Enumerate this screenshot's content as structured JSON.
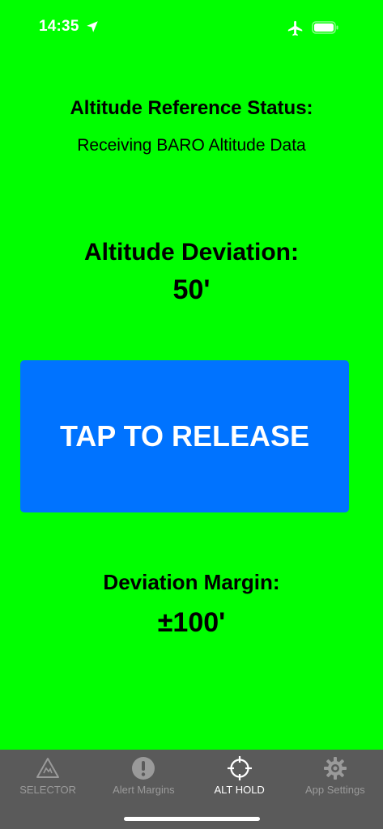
{
  "status_bar": {
    "time": "14:35",
    "icons": [
      "location-arrow-icon",
      "airplane-icon",
      "battery-icon"
    ]
  },
  "altitude_reference": {
    "title": "Altitude Reference Status:",
    "status": "Receiving BARO Altitude Data"
  },
  "altitude_deviation": {
    "title": "Altitude Deviation:",
    "value": "50'"
  },
  "release_button": {
    "label": "TAP TO RELEASE"
  },
  "deviation_margin": {
    "title": "Deviation Margin:",
    "value": "±100'"
  },
  "tabs": [
    {
      "label": "SELECTOR",
      "icon": "selector-warning-icon",
      "active": false
    },
    {
      "label": "Alert Margins",
      "icon": "exclamation-circle-icon",
      "active": false
    },
    {
      "label": "ALT HOLD",
      "icon": "crosshair-icon",
      "active": true
    },
    {
      "label": "App Settings",
      "icon": "gear-icon",
      "active": false
    }
  ],
  "colors": {
    "background": "#00ff00",
    "button": "#0073ff",
    "tab_bar": "#5a5a5a",
    "tab_inactive": "#9a9a9a",
    "tab_active": "#ffffff"
  }
}
